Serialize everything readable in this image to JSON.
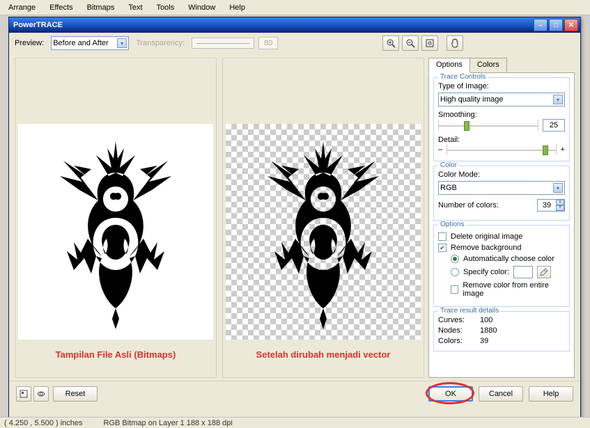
{
  "menu": {
    "arrange": "Arrange",
    "effects": "Effects",
    "bitmaps": "Bitmaps",
    "text": "Text",
    "tools": "Tools",
    "window": "Window",
    "help": "Help"
  },
  "dialog": {
    "title": "PowerTRACE",
    "preview_label": "Preview:",
    "preview_select": "Before and After",
    "transparency_label": "Transparency:",
    "transparency_value": "80",
    "tabs": {
      "options": "Options",
      "colors": "Colors"
    },
    "trace_controls": {
      "group": "Trace Controls",
      "type_label": "Type of Image:",
      "type_value": "High quality image",
      "smoothing_label": "Smoothing:",
      "smoothing_value": "25",
      "detail_label": "Detail:",
      "minus": "–",
      "plus": "+"
    },
    "color": {
      "group": "Color",
      "mode_label": "Color Mode:",
      "mode_value": "RGB",
      "numcolors_label": "Number of colors:",
      "numcolors_value": "39"
    },
    "options": {
      "group": "Options",
      "delete_orig": "Delete original image",
      "remove_bg": "Remove background",
      "auto_color": "Automatically choose color",
      "specify_color": "Specify color:",
      "remove_entire": "Remove color from entire image"
    },
    "result": {
      "group": "Trace result details",
      "curves_l": "Curves:",
      "curves_v": "100",
      "nodes_l": "Nodes:",
      "nodes_v": "1880",
      "colors_l": "Colors:",
      "colors_v": "39"
    },
    "captions": {
      "left": "Tampilan File Asli (Bitmaps)",
      "right": "Setelah dirubah menjadi vector"
    },
    "buttons": {
      "reset": "Reset",
      "ok": "OK",
      "cancel": "Cancel",
      "help": "Help"
    }
  },
  "status": {
    "coord": "( 4.250 , 5.500 ) inches",
    "info": "RGB Bitmap on Layer 1  188 x 188 dpi"
  }
}
